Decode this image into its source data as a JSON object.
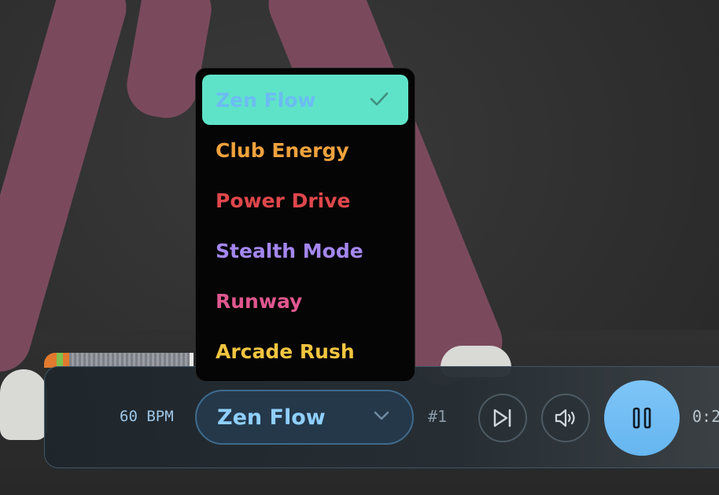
{
  "player": {
    "bpm": "60 BPM",
    "preset_select": {
      "value": "Zen Flow"
    },
    "preset_number": "#1",
    "time": "0:2"
  },
  "preset_menu": {
    "options": [
      {
        "label": "Zen Flow",
        "color": "#6bbcf2",
        "selected": true
      },
      {
        "label": "Club Energy",
        "color": "#f0a13d",
        "selected": false
      },
      {
        "label": "Power Drive",
        "color": "#e0474c",
        "selected": false
      },
      {
        "label": "Stealth Mode",
        "color": "#a487f0",
        "selected": false
      },
      {
        "label": "Runway",
        "color": "#e0578f",
        "selected": false
      },
      {
        "label": "Arcade Rush",
        "color": "#f1c540",
        "selected": false
      }
    ]
  },
  "colors": {
    "accent": "#6bbcf2",
    "selected_option_bg": "#5fe3c8",
    "play_button": "#7ec5f8"
  }
}
